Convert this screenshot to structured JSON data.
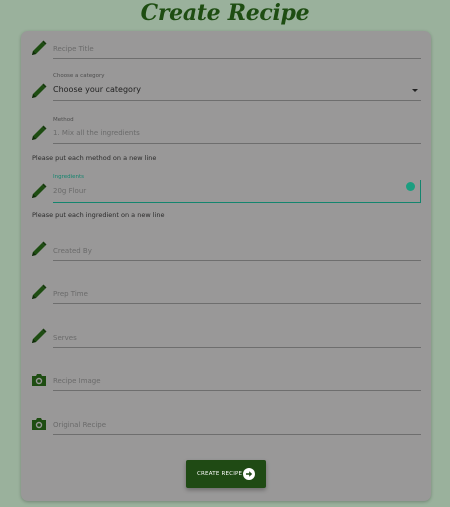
{
  "page": {
    "title": "Create Recipe"
  },
  "form": {
    "recipe_title": {
      "placeholder": "Recipe Title"
    },
    "category": {
      "label": "Choose a category",
      "value": "Choose your category"
    },
    "method": {
      "label": "Method",
      "placeholder": "1. Mix all the ingredients",
      "helper": "Please put each method on a new line"
    },
    "ingredients": {
      "label": "Ingredients",
      "placeholder": "20g Flour",
      "helper": "Please put each ingredient on a new line"
    },
    "created_by": {
      "placeholder": "Created By"
    },
    "prep_time": {
      "placeholder": "Prep Time"
    },
    "serves": {
      "placeholder": "Serves"
    },
    "recipe_image": {
      "placeholder": "Recipe Image"
    },
    "original_recipe": {
      "placeholder": "Original Recipe"
    },
    "submit": {
      "label": "CREATE RECIPE"
    }
  },
  "colors": {
    "background": "#9ab19c",
    "card": "#999898",
    "brand_green": "#1e4d12",
    "active_teal": "#13856e",
    "status_dot": "#1b9e80"
  },
  "icons": {
    "pencil": "pencil-icon",
    "camera": "camera-icon",
    "arrow": "arrow-circle-right-icon",
    "dropdown": "caret-down-icon"
  }
}
